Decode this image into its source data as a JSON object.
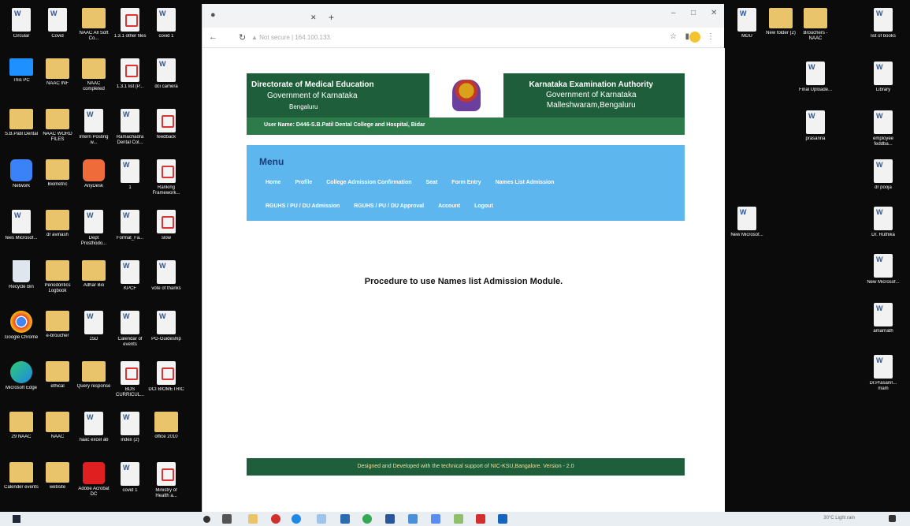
{
  "desktop_left": [
    {
      "label": "Circular",
      "kind": "word"
    },
    {
      "label": "Covid",
      "kind": "word"
    },
    {
      "label": "NAAC All Soft Co...",
      "kind": "folder"
    },
    {
      "label": "1.3.1 other files",
      "kind": "pdf"
    },
    {
      "label": "covid 1",
      "kind": "word"
    },
    {
      "label": "This PC",
      "kind": "pc"
    },
    {
      "label": "NAAC INF",
      "kind": "folder"
    },
    {
      "label": "NAAC completed",
      "kind": "folder"
    },
    {
      "label": "1.3.1 list (P...",
      "kind": "pdf"
    },
    {
      "label": "dci camera",
      "kind": "word"
    },
    {
      "label": "S.B.Patil Dental",
      "kind": "folder"
    },
    {
      "label": "NAAC WORD FILES",
      "kind": "folder"
    },
    {
      "label": "Intern Posting w...",
      "kind": "word"
    },
    {
      "label": "Ramachadra Dental Col...",
      "kind": "word"
    },
    {
      "label": "feedback",
      "kind": "pdf"
    },
    {
      "label": "Network",
      "kind": "app"
    },
    {
      "label": "Biometric",
      "kind": "folder"
    },
    {
      "label": "AnyDesk",
      "kind": "any"
    },
    {
      "label": "1",
      "kind": "word"
    },
    {
      "label": "Ranking Framework...",
      "kind": "pdf"
    },
    {
      "label": "fees Microsof...",
      "kind": "word"
    },
    {
      "label": "dr avinash",
      "kind": "folder"
    },
    {
      "label": "Dept Prosthodo...",
      "kind": "word"
    },
    {
      "label": "Format_Fa...",
      "kind": "word"
    },
    {
      "label": "slow",
      "kind": "pdf"
    },
    {
      "label": "Recycle Bin",
      "kind": "bin"
    },
    {
      "label": "Periodontics Logbook",
      "kind": "folder"
    },
    {
      "label": "Adhar Bio",
      "kind": "folder"
    },
    {
      "label": "KPCF",
      "kind": "word"
    },
    {
      "label": "vote of thanks",
      "kind": "word"
    },
    {
      "label": "Google Chrome",
      "kind": "chrome"
    },
    {
      "label": "e-broucher",
      "kind": "folder"
    },
    {
      "label": "15D",
      "kind": "word"
    },
    {
      "label": "Calendar of events",
      "kind": "word"
    },
    {
      "label": "PG-Guideship",
      "kind": "word"
    },
    {
      "label": "Microsoft Edge",
      "kind": "edge"
    },
    {
      "label": "ethical",
      "kind": "folder"
    },
    {
      "label": "Query response",
      "kind": "folder"
    },
    {
      "label": "BDS CURRICUL...",
      "kind": "pdf"
    },
    {
      "label": "DCI BIOMETRIC",
      "kind": "pdf"
    },
    {
      "label": "29 NAAC",
      "kind": "folder"
    },
    {
      "label": "NAAC",
      "kind": "folder"
    },
    {
      "label": "naac excel ab",
      "kind": "word"
    },
    {
      "label": "index (2)",
      "kind": "word"
    },
    {
      "label": "office 2010",
      "kind": "folder"
    },
    {
      "label": "Calender events",
      "kind": "folder"
    },
    {
      "label": "website",
      "kind": "folder"
    },
    {
      "label": "Adobe Acrobat DC",
      "kind": "acrobat"
    },
    {
      "label": "covid 1",
      "kind": "word"
    },
    {
      "label": "Ministry of Health a...",
      "kind": "pdf"
    }
  ],
  "desktop_right": [
    {
      "label": "MDU",
      "kind": "word"
    },
    {
      "label": "New folder (2)",
      "kind": "folder"
    },
    {
      "label": "Brouchers - NAAC",
      "kind": "folder"
    },
    {
      "label": "list of books",
      "kind": "word"
    },
    {
      "label": "Final Uploade...",
      "kind": "word"
    },
    {
      "label": "Library",
      "kind": "word"
    },
    {
      "label": "prasanna",
      "kind": "word"
    },
    {
      "label": "employee feddba...",
      "kind": "word"
    },
    {
      "label": "dr pooja",
      "kind": "word"
    },
    {
      "label": "New Microsof...",
      "kind": "word"
    },
    {
      "label": "Dr. Ruthika",
      "kind": "word"
    },
    {
      "label": "New Microsof...",
      "kind": "word"
    },
    {
      "label": "amarnath",
      "kind": "word"
    },
    {
      "label": "Dr.Prasann... mam",
      "kind": "word"
    }
  ],
  "browser": {
    "url": "▲ Not secure | 164.100.133.",
    "header": {
      "left_l1": "Directorate of Medical Education",
      "left_l2": "Government of Karnataka",
      "left_l3": "Bengaluru",
      "right_l1": "Karnataka Examination Authority",
      "right_l2": "Government of Karnataka",
      "right_l3": "Malleshwaram,Bengaluru"
    },
    "user_name": "User Name: D446-S.B.Patil Dental College and Hospital, Bidar",
    "menu": {
      "title": "Menu",
      "row1": [
        "Home",
        "Profile",
        "College Admission Confirmation",
        "Seat",
        "Form Entry",
        "Names List Admission"
      ],
      "row2": [
        "RGUHS / PU / DU Admission",
        "RGUHS / PU / DU Approval",
        "Account",
        "Logout"
      ]
    },
    "procedure_title": "Procedure to use Names list Admission Module.",
    "footer": "Designed and Developed with the technical support of  NIC-KSU,Bangalore.  Version - 2.0"
  },
  "taskbar": {
    "tray": "30°C Light rain",
    "clock": ""
  }
}
